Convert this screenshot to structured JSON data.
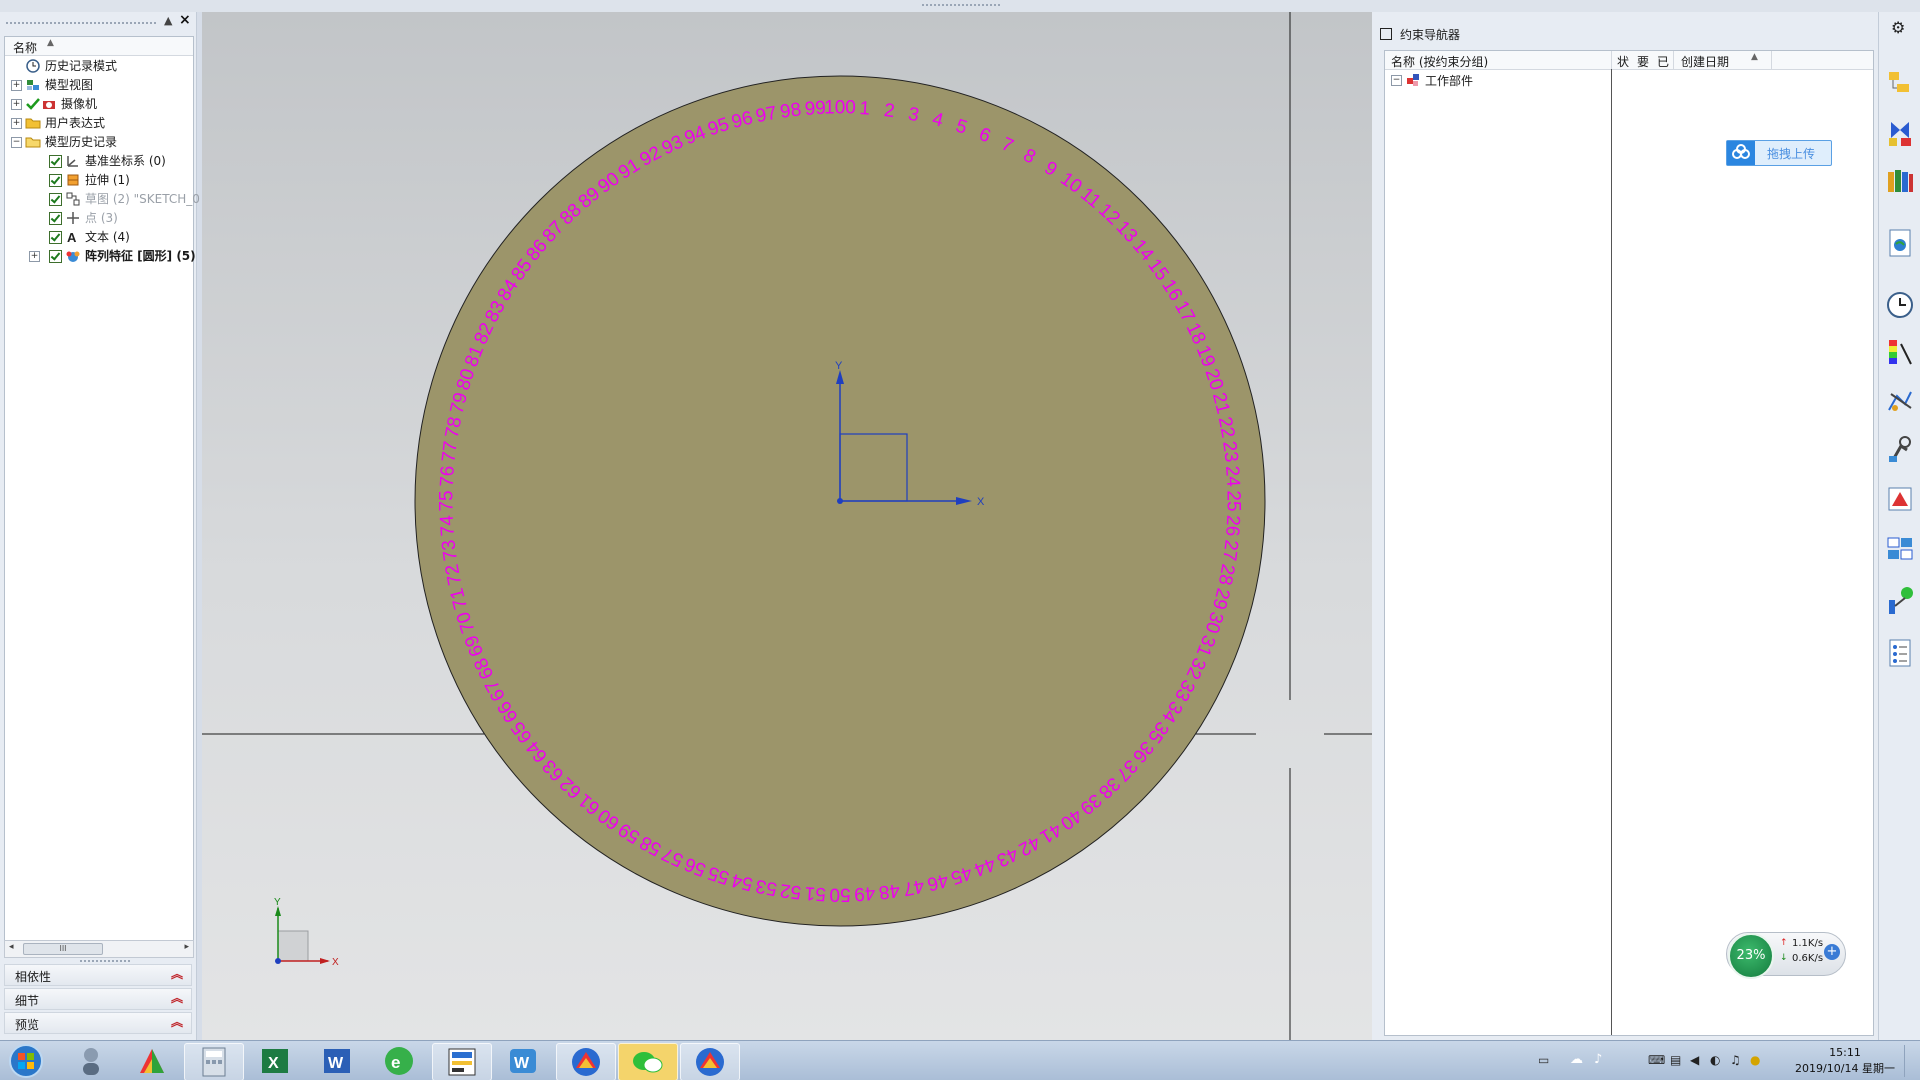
{
  "left_panel": {
    "header_name": "名称",
    "tree": [
      {
        "label": "历史记录模式",
        "icon": "history-clock-icon",
        "indent": 0,
        "expander": false,
        "checked": false
      },
      {
        "label": "模型视图",
        "icon": "model-views-icon",
        "indent": 0,
        "expander": true,
        "checked": false
      },
      {
        "label": "摄像机",
        "icon": "camera-icon",
        "indent": 0,
        "expander": true,
        "checked": true
      },
      {
        "label": "用户表达式",
        "icon": "folder-icon",
        "indent": 0,
        "expander": true,
        "checked": false
      },
      {
        "label": "模型历史记录",
        "icon": "folder-open-icon",
        "indent": 0,
        "expander": true,
        "checked": false
      },
      {
        "label": "基准坐标系 (0)",
        "icon": "datum-csys-icon",
        "indent": 1,
        "checked": true
      },
      {
        "label": "拉伸 (1)",
        "icon": "extrude-icon",
        "indent": 1,
        "checked": true
      },
      {
        "label": "草图 (2) \"SKETCH_0",
        "icon": "sketch-icon",
        "indent": 1,
        "checked": true,
        "grey": true
      },
      {
        "label": "点 (3)",
        "icon": "point-icon",
        "indent": 1,
        "checked": true,
        "grey": true
      },
      {
        "label": "文本 (4)",
        "icon": "text-icon",
        "indent": 1,
        "checked": true
      },
      {
        "label": "阵列特征 [圆形] (5)",
        "icon": "pattern-feature-icon",
        "indent": 1,
        "checked": true,
        "bold": true,
        "expander": true
      }
    ],
    "scroll_thumb": "III",
    "accordions": [
      "相依性",
      "细节",
      "预览"
    ]
  },
  "nav_panel": {
    "title": "约束导航器",
    "columns": [
      "名称 (按约束分组)",
      "状",
      "要",
      "已",
      "创建日期"
    ],
    "root_item": "工作部件"
  },
  "upload_button": "拖拽上传",
  "viewport": {
    "dial_numbers": [
      "1",
      "2",
      "3",
      "4",
      "5",
      "6",
      "7",
      "8",
      "9",
      "10",
      "11",
      "12",
      "13",
      "14",
      "15",
      "16",
      "17",
      "18",
      "19",
      "20",
      "21",
      "22",
      "23",
      "24",
      "25",
      "26",
      "27",
      "28",
      "29",
      "30",
      "31",
      "32",
      "33",
      "34",
      "35",
      "36",
      "37",
      "38",
      "39",
      "40",
      "41",
      "42",
      "43",
      "44",
      "45",
      "46",
      "47",
      "48",
      "49",
      "50",
      "51",
      "52",
      "53",
      "54",
      "55",
      "56",
      "57",
      "58",
      "59",
      "60",
      "61",
      "62",
      "63",
      "64",
      "65",
      "66",
      "67",
      "68",
      "69",
      "70",
      "71",
      "72",
      "73",
      "74",
      "75",
      "76",
      "77",
      "78",
      "79",
      "80",
      "81",
      "82",
      "83",
      "84",
      "85",
      "86",
      "87",
      "88",
      "89",
      "90",
      "91",
      "92",
      "93",
      "94",
      "95",
      "96",
      "97",
      "98",
      "99",
      "100"
    ],
    "disk_color": "#9c956a",
    "number_color": "#ee00ee",
    "axis_x": "X",
    "axis_y": "Y"
  },
  "net_widget": {
    "percent": "23%",
    "up": "1.1K/s",
    "down": "0.6K/s"
  },
  "taskbar": {
    "time": "15:11",
    "date": "2019/10/14 星期一",
    "apps": [
      "start-button",
      "user-app",
      "nx-app",
      "calculator-app",
      "excel-app",
      "word-app",
      "browser-app",
      "ie-app",
      "wps-app",
      "nx-window-1",
      "wechat-app",
      "nx-window-2"
    ]
  }
}
